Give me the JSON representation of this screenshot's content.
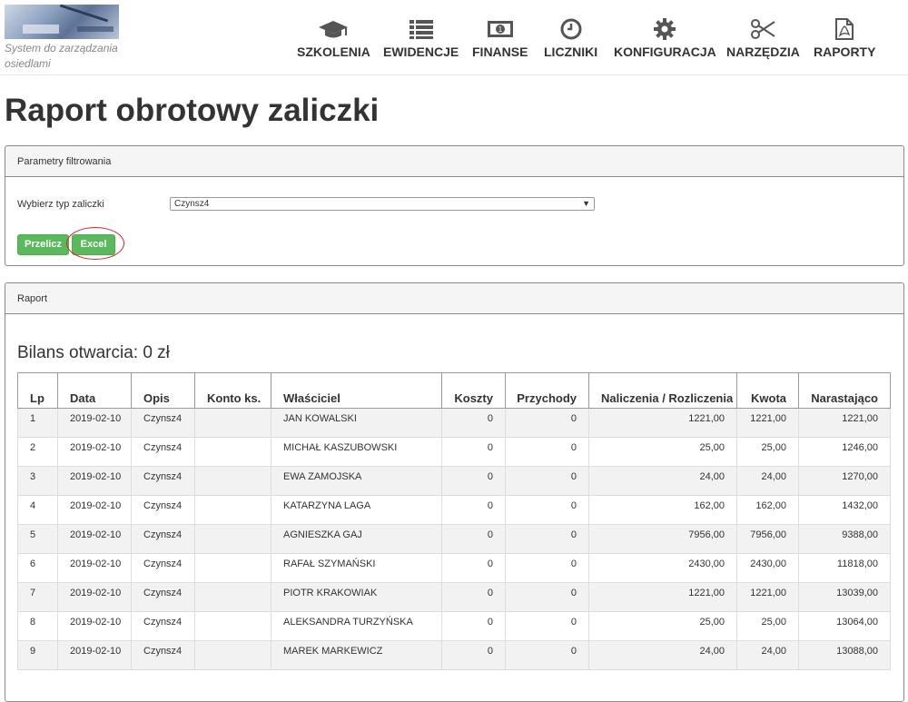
{
  "header": {
    "tagline": "System do zarządzania osiedlami",
    "nav": [
      {
        "label": "SZKOLENIA",
        "icon": "graduation-cap-icon"
      },
      {
        "label": "EWIDENCJE",
        "icon": "list-icon"
      },
      {
        "label": "FINANSE",
        "icon": "money-icon"
      },
      {
        "label": "LICZNIKI",
        "icon": "clock-icon"
      },
      {
        "label": "KONFIGURACJA",
        "icon": "gear-icon"
      },
      {
        "label": "NARZĘDZIA",
        "icon": "scissors-icon"
      },
      {
        "label": "RAPORTY",
        "icon": "pdf-file-icon"
      }
    ]
  },
  "page": {
    "title": "Raport obrotowy zaliczki"
  },
  "filter": {
    "heading": "Parametry filtrowania",
    "type_label": "Wybierz typ zaliczki",
    "type_value": "Czynsz4",
    "przelicz_label": "Przelicz",
    "excel_label": "Excel"
  },
  "report": {
    "heading": "Raport",
    "opening_balance": "Bilans otwarcia: 0 zł",
    "columns": {
      "lp": "Lp",
      "data": "Data",
      "opis": "Opis",
      "konto": "Konto ks.",
      "wlasciciel": "Właściciel",
      "koszty": "Koszty",
      "przychody": "Przychody",
      "naliczenia": "Naliczenia / Rozliczenia",
      "kwota": "Kwota",
      "narastajaco": "Narastająco"
    },
    "rows": [
      {
        "lp": "1",
        "data": "2019-02-10",
        "opis": "Czynsz4",
        "konto": "",
        "wlasciciel": "JAN KOWALSKI",
        "koszty": "0",
        "przychody": "0",
        "naliczenia": "1221,00",
        "kwota": "1221,00",
        "narastajaco": "1221,00"
      },
      {
        "lp": "2",
        "data": "2019-02-10",
        "opis": "Czynsz4",
        "konto": "",
        "wlasciciel": "MICHAŁ KASZUBOWSKI",
        "koszty": "0",
        "przychody": "0",
        "naliczenia": "25,00",
        "kwota": "25,00",
        "narastajaco": "1246,00"
      },
      {
        "lp": "3",
        "data": "2019-02-10",
        "opis": "Czynsz4",
        "konto": "",
        "wlasciciel": "EWA ZAMOJSKA",
        "koszty": "0",
        "przychody": "0",
        "naliczenia": "24,00",
        "kwota": "24,00",
        "narastajaco": "1270,00"
      },
      {
        "lp": "4",
        "data": "2019-02-10",
        "opis": "Czynsz4",
        "konto": "",
        "wlasciciel": "KATARZYNA LAGA",
        "koszty": "0",
        "przychody": "0",
        "naliczenia": "162,00",
        "kwota": "162,00",
        "narastajaco": "1432,00"
      },
      {
        "lp": "5",
        "data": "2019-02-10",
        "opis": "Czynsz4",
        "konto": "",
        "wlasciciel": "AGNIESZKA GAJ",
        "koszty": "0",
        "przychody": "0",
        "naliczenia": "7956,00",
        "kwota": "7956,00",
        "narastajaco": "9388,00"
      },
      {
        "lp": "6",
        "data": "2019-02-10",
        "opis": "Czynsz4",
        "konto": "",
        "wlasciciel": "RAFAŁ SZYMAŃSKI",
        "koszty": "0",
        "przychody": "0",
        "naliczenia": "2430,00",
        "kwota": "2430,00",
        "narastajaco": "11818,00"
      },
      {
        "lp": "7",
        "data": "2019-02-10",
        "opis": "Czynsz4",
        "konto": "",
        "wlasciciel": "PIOTR KRAKOWIAK",
        "koszty": "0",
        "przychody": "0",
        "naliczenia": "1221,00",
        "kwota": "1221,00",
        "narastajaco": "13039,00"
      },
      {
        "lp": "8",
        "data": "2019-02-10",
        "opis": "Czynsz4",
        "konto": "",
        "wlasciciel": "ALEKSANDRA TURZYŃSKA",
        "koszty": "0",
        "przychody": "0",
        "naliczenia": "25,00",
        "kwota": "25,00",
        "narastajaco": "13064,00"
      },
      {
        "lp": "9",
        "data": "2019-02-10",
        "opis": "Czynsz4",
        "konto": "",
        "wlasciciel": "MAREK MARKEWICZ",
        "koszty": "0",
        "przychody": "0",
        "naliczenia": "24,00",
        "kwota": "24,00",
        "narastajaco": "13088,00"
      }
    ]
  },
  "colors": {
    "accent_green": "#5cb85c",
    "highlight_red": "#d9232d"
  }
}
